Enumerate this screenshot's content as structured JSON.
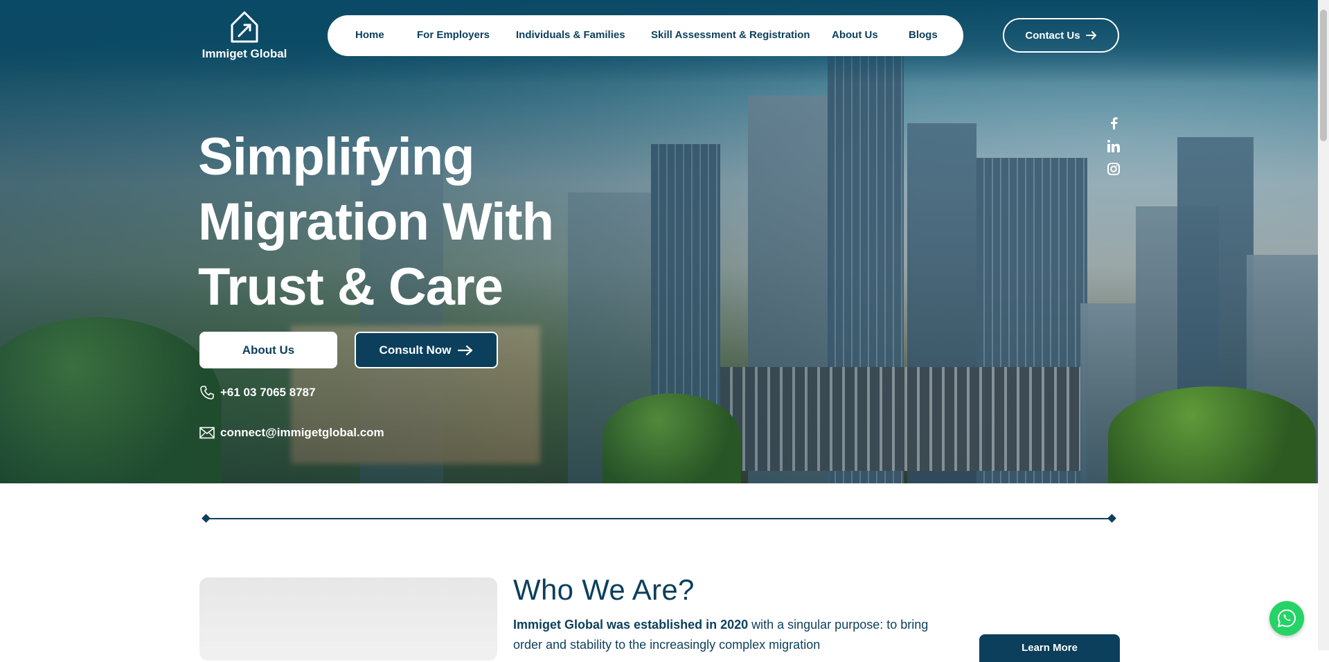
{
  "brand": {
    "name": "Immiget Global",
    "logo_icon": "plane-house-icon"
  },
  "nav": {
    "items": [
      {
        "label": "Home"
      },
      {
        "label": "For Employers"
      },
      {
        "label": "Individuals & Families"
      },
      {
        "label": "Skill Assessment & Registration"
      },
      {
        "label": "About Us"
      },
      {
        "label": "Blogs"
      }
    ],
    "contact_label": "Contact Us"
  },
  "social": [
    "facebook-icon",
    "linkedin-icon",
    "instagram-icon"
  ],
  "hero": {
    "headline_line1": "Simplifying",
    "headline_line2": "Migration With",
    "headline_line3": "Trust & Care",
    "about_label": "About Us",
    "consult_label": "Consult Now",
    "phone": "+61 03 7065 8787",
    "email": "connect@immigetglobal.com"
  },
  "who": {
    "title": "Who We Are?",
    "text_bold": "Immiget Global was established in 2020",
    "text_rest": " with a singular purpose: to bring order and stability to the increasingly complex migration",
    "button_label": "Learn More"
  },
  "colors": {
    "primary": "#0b3f5c",
    "white": "#ffffff",
    "whatsapp": "#25d366"
  }
}
